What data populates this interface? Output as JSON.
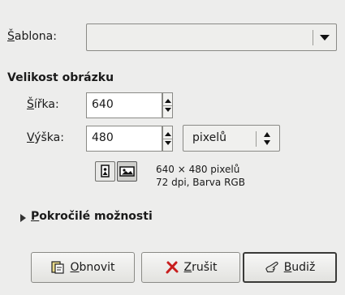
{
  "template": {
    "label_mnemonic": "Š",
    "label_rest": "ablona:",
    "value": ""
  },
  "image_size": {
    "heading": "Velikost obrázku",
    "width": {
      "label_mnemonic": "Š",
      "label_rest": "ířka:",
      "value": "640"
    },
    "height": {
      "label_mnemonic": "V",
      "label_rest": "ýška:",
      "value": "480"
    },
    "unit": "pixelů",
    "orientation": {
      "portrait_icon": "portrait-icon",
      "landscape_icon": "landscape-icon",
      "selected": "landscape"
    },
    "info_line1": "640 × 480 pixelů",
    "info_line2": "72 dpi, Barva RGB"
  },
  "advanced": {
    "label_mnemonic": "P",
    "label_rest": "okročilé možnosti"
  },
  "buttons": {
    "reset": {
      "mnemonic": "O",
      "rest": "bnovit",
      "icon": "reset-icon"
    },
    "cancel": {
      "mnemonic": "Z",
      "rest": "rušit",
      "icon": "cancel-icon"
    },
    "ok": {
      "mnemonic": "B",
      "rest": "udiž",
      "icon": "ok-icon"
    }
  },
  "colors": {
    "background": "#ededec",
    "field": "#ffffff",
    "border": "#8a8a86"
  }
}
